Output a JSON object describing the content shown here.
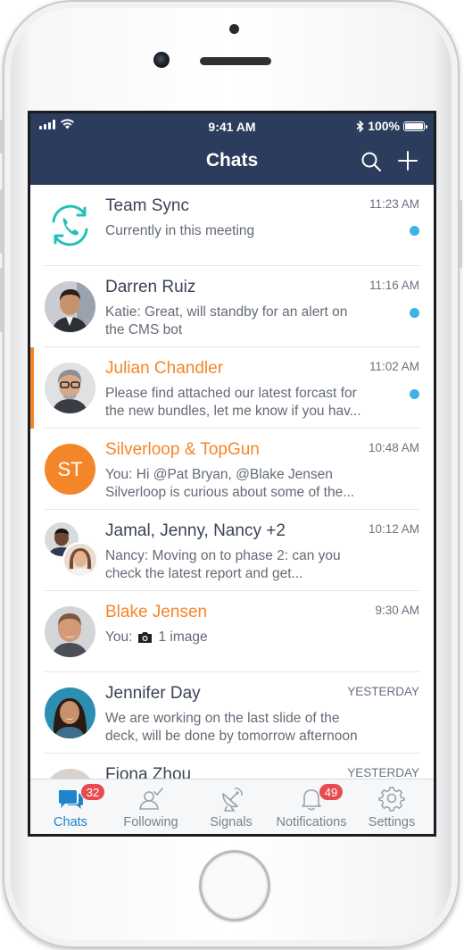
{
  "status_bar": {
    "time": "9:41 AM",
    "battery": "100%"
  },
  "nav": {
    "title": "Chats"
  },
  "chats": [
    {
      "name": "Team Sync",
      "time": "11:23 AM",
      "preview": "Currently in this meeting",
      "unread": true,
      "highlight": false,
      "bar": false
    },
    {
      "name": "Darren Ruiz",
      "time": "11:16 AM",
      "preview": "Katie: Great, will standby for an alert on\nthe CMS bot",
      "unread": true,
      "highlight": false,
      "bar": false
    },
    {
      "name": "Julian Chandler",
      "time": "11:02 AM",
      "preview": "Please find attached our latest forcast for\nthe new bundles, let me know if you hav...",
      "unread": true,
      "highlight": true,
      "bar": true
    },
    {
      "name": "Silverloop & TopGun",
      "time": "10:48 AM",
      "preview": "You: Hi @Pat Bryan, @Blake Jensen\nSilverloop is curious about some of the...",
      "unread": false,
      "highlight": true,
      "bar": false,
      "initials": "ST"
    },
    {
      "name": "Jamal, Jenny, Nancy +2",
      "time": "10:12 AM",
      "preview": "Nancy: Moving on to phase 2: can you\ncheck the latest report and get...",
      "unread": false,
      "highlight": false,
      "bar": false
    },
    {
      "name": "Blake Jensen",
      "time": "9:30 AM",
      "preview_prefix": "You:",
      "preview_suffix": "1 image",
      "unread": false,
      "highlight": true,
      "bar": false
    },
    {
      "name": "Jennifer Day",
      "time": "YESTERDAY",
      "preview": "We are working on the last slide of the\ndeck, will be done by tomorrow afternoon",
      "unread": false,
      "highlight": false,
      "bar": false
    },
    {
      "name": "Fiona Zhou",
      "time": "YESTERDAY",
      "preview": "",
      "unread": false,
      "highlight": false,
      "bar": false
    }
  ],
  "tabs": [
    {
      "label": "Chats",
      "badge": "32",
      "active": true,
      "icon": "chat-bubbles-icon"
    },
    {
      "label": "Following",
      "badge": "",
      "active": false,
      "icon": "following-icon"
    },
    {
      "label": "Signals",
      "badge": "",
      "active": false,
      "icon": "satellite-dish-icon"
    },
    {
      "label": "Notifications",
      "badge": "49",
      "active": false,
      "icon": "bell-icon"
    },
    {
      "label": "Settings",
      "badge": "",
      "active": false,
      "icon": "gear-icon"
    }
  ],
  "colors": {
    "header": "#2b3c5c",
    "accent_orange": "#f4862a",
    "unread_dot": "#3db2e6",
    "badge": "#e84c4f",
    "active_tab": "#1f84c9",
    "team_sync_icon": "#22c1b8"
  }
}
